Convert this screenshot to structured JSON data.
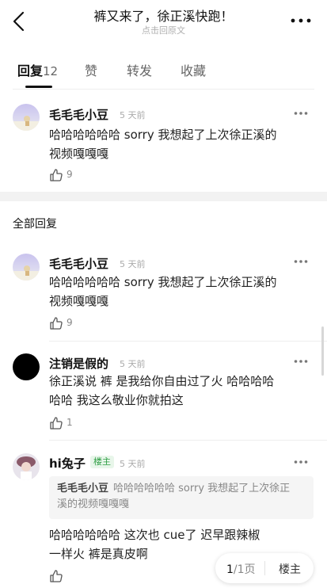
{
  "header": {
    "title": "裤又来了，徐正溪快跑！",
    "subtitle": "点击回原文",
    "back_icon": "chevron-left-icon",
    "more_icon": "more-horizontal-icon"
  },
  "tabs": [
    {
      "label": "回复",
      "count": "12"
    },
    {
      "label": "赞"
    },
    {
      "label": "转发"
    },
    {
      "label": "收藏"
    }
  ],
  "original_comment": {
    "user": "毛毛毛小豆",
    "time": "5 天前",
    "text_line1": "哈哈哈哈哈哈 sorry 我想起了上次徐正溪的",
    "text_line2": "视频嘎嘎嘎",
    "likes": "9"
  },
  "section": {
    "title": "全部回复"
  },
  "replies": [
    {
      "user": "毛毛毛小豆",
      "time": "5 天前",
      "text_line1": "哈哈哈哈哈哈 sorry 我想起了上次徐正溪的",
      "text_line2": "视频嘎嘎嘎",
      "likes": "9"
    },
    {
      "user": "注销是假的",
      "time": "5 天前",
      "text_line1": "徐正溪说 裤 是我给你自由过了火  哈哈哈哈",
      "text_line2": "哈哈 我这么敬业你就拍这",
      "likes": "1"
    },
    {
      "user": "hi兔子",
      "badge": "楼主",
      "time": "5 天前",
      "quote_user": "毛毛毛小豆",
      "quote_line1": "哈哈哈哈哈哈 sorry 我想起了上次徐正",
      "quote_line2": "溪的视频嘎嘎嘎",
      "text_line1": "哈哈哈哈哈哈 这次也 cue了  迟早跟辣椒",
      "text_line2": "一样火 裤是真皮啊"
    }
  ],
  "pager": {
    "current": "1",
    "total": "/1页",
    "floor_label": "楼主"
  },
  "colors": {
    "owner_badge": "#2e9e44",
    "divider": "#eeeeee",
    "gap": "#f2f2f2"
  }
}
